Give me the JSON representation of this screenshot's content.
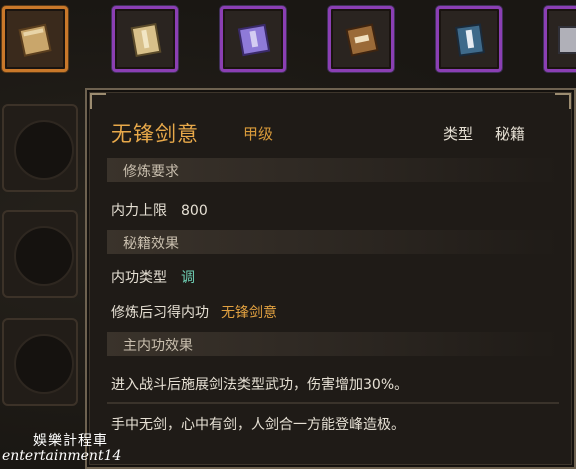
{
  "skill_slots": [
    {
      "icon": "tan-book-icon",
      "selected": true
    },
    {
      "icon": "tan-book-icon",
      "selected": false
    },
    {
      "icon": "purple-book-icon",
      "selected": false
    },
    {
      "icon": "brown-book-icon",
      "selected": false
    },
    {
      "icon": "blue-book-icon",
      "selected": false
    },
    {
      "icon": "book-icon",
      "selected": false
    }
  ],
  "tooltip": {
    "name": "无锋剑意",
    "grade": "甲级",
    "type_label": "类型",
    "type_value": "秘籍",
    "requirements_header": "修炼要求",
    "max_neili_label": "内力上限",
    "max_neili_value": "800",
    "effect_header": "秘籍效果",
    "inner_type_label": "内功类型",
    "inner_type_value": "调",
    "learned_label": "修炼后习得内功",
    "learned_value": "无锋剑意",
    "main_effect_header": "主内功效果",
    "main_effect_text": "进入战斗后施展剑法类型武功，伤害增加30%。",
    "flavor_text": "手中无剑，心中有剑，人剑合一方能登峰造极。"
  },
  "watermark": {
    "line1": "娛樂計程車",
    "line2": "entertainment14"
  },
  "colors": {
    "name": "#e8a94a",
    "teal": "#6fd0b5",
    "slot_border": "#8b3fb3",
    "selected_border": "#c9782a"
  }
}
